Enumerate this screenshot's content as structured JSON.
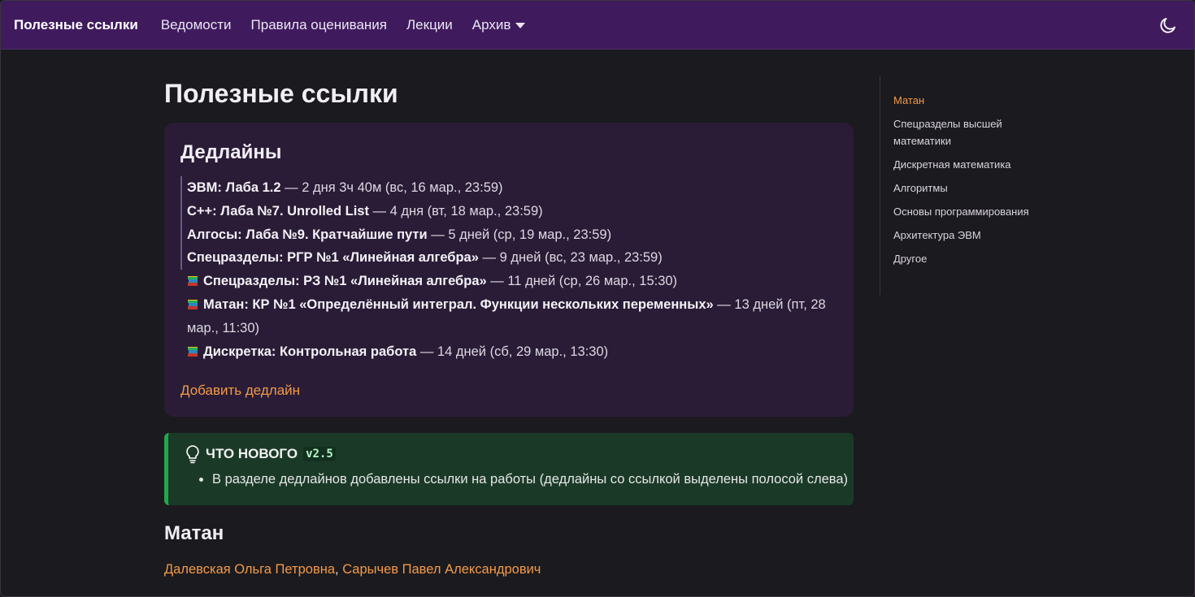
{
  "navbar": {
    "brand": "Полезные ссылки",
    "links": [
      "Ведомости",
      "Правила оценивания",
      "Лекции"
    ],
    "archive": "Архив",
    "theme_icon": "moon-icon"
  },
  "page": {
    "title": "Полезные ссылки"
  },
  "deadlines": {
    "title": "Дедлайны",
    "items": [
      {
        "name": "ЭВМ: Лаба 1.2",
        "rest": " — 2 дня 3ч 40м (вс, 16 мар., 23:59)",
        "linked": true
      },
      {
        "name": "C++: Лаба №7. Unrolled List",
        "rest": " — 4 дня (вт, 18 мар., 23:59)",
        "linked": true
      },
      {
        "name": "Алгосы: Лаба №9. Кратчайшие пути",
        "rest": " — 5 дней (ср, 19 мар., 23:59)",
        "linked": true
      },
      {
        "name": "Спецразделы: РГР №1 «Линейная алгебра»",
        "rest": " — 9 дней (вс, 23 мар., 23:59)",
        "linked": true
      },
      {
        "name": "Спецразделы: РЗ №1 «Линейная алгебра»",
        "rest": " — 11 дней (ср, 26 мар., 15:30)",
        "linked": false,
        "icon": "books-icon"
      },
      {
        "name": "Матан: КР №1 «Определённый интеграл. Функции нескольких переменных»",
        "rest": " — 13 дней (пт, 28 мар., 11:30)",
        "linked": false,
        "icon": "books-icon"
      },
      {
        "name": "Дискретка: Контрольная работа",
        "rest": " — 14 дней (сб, 29 мар., 13:30)",
        "linked": false,
        "icon": "books-icon"
      }
    ],
    "add_label": "Добавить дедлайн"
  },
  "whats_new": {
    "title": "ЧТО НОВОГО",
    "version": "v2.5",
    "items": [
      "В разделе дедлайнов добавлены ссылки на работы (дедлайны со ссылкой выделены полосой слева)"
    ]
  },
  "matan": {
    "title": "Матан",
    "person1": "Далевская Ольга Петровна",
    "separator": ", ",
    "person2": "Сарычев Павел Александрович"
  },
  "toc": {
    "items": [
      "Матан",
      "Спецразделы высшей математики",
      "Дискретная математика",
      "Алгоритмы",
      "Основы программирования",
      "Архитектура ЭВМ",
      "Другое"
    ],
    "active": "Матан"
  },
  "colors": {
    "navbar": "#3f1b5e",
    "background": "#1b1a1e",
    "card": "#2a1c36",
    "link": "#f29a4a",
    "tip_border": "#1fa84b",
    "tip_bg": "#1a3a27"
  }
}
